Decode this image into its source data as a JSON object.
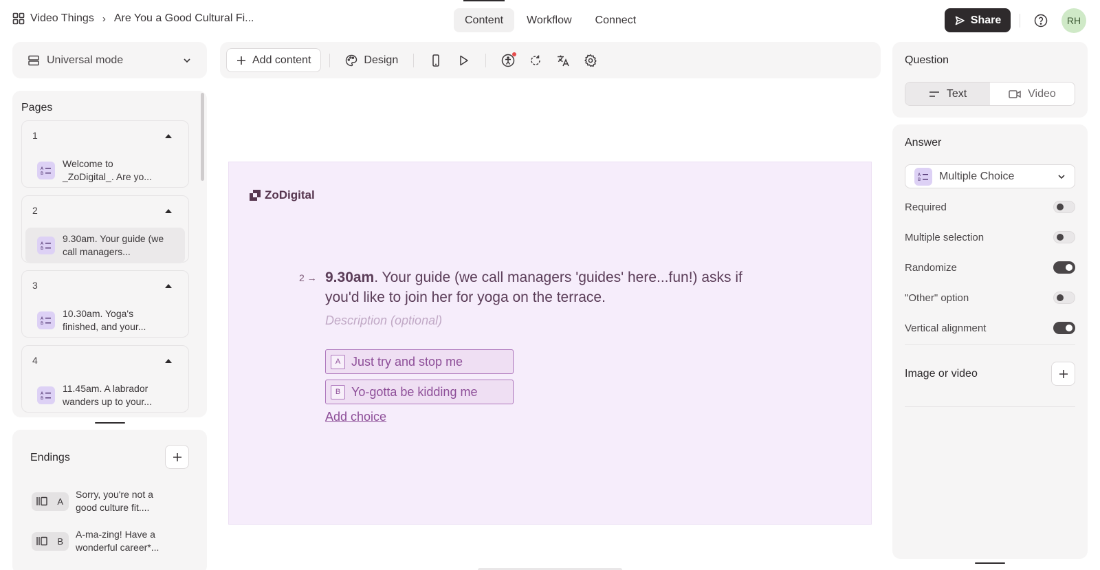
{
  "header": {
    "breadcrumb_root": "Video Things",
    "breadcrumb_current": "Are You a Good Cultural Fi...",
    "tabs": [
      {
        "label": "Content",
        "active": true
      },
      {
        "label": "Workflow",
        "active": false
      },
      {
        "label": "Connect",
        "active": false
      }
    ],
    "share_label": "Share",
    "avatar_initials": "RH"
  },
  "sidebar": {
    "mode_label": "Universal mode",
    "pages_title": "Pages",
    "pages": [
      {
        "number": "1",
        "text": "Welcome to _ZoDigital_. Are yo...",
        "selected": false
      },
      {
        "number": "2",
        "text": "9.30am. Your guide (we call managers...",
        "selected": true
      },
      {
        "number": "3",
        "text": "10.30am. Yoga's finished, and your...",
        "selected": false
      },
      {
        "number": "4",
        "text": "11.45am. A labrador wanders up to your...",
        "selected": false
      }
    ],
    "endings_title": "Endings",
    "endings": [
      {
        "key": "A",
        "text": "Sorry, you're not a good culture fit...."
      },
      {
        "key": "B",
        "text": "A-ma-zing! Have a wonderful career*..."
      }
    ]
  },
  "toolbar": {
    "add_content_label": "Add content",
    "design_label": "Design",
    "icons": [
      "mobile-preview-icon",
      "play-icon",
      "accessibility-icon",
      "refresh-icon",
      "translate-icon",
      "settings-icon"
    ]
  },
  "canvas": {
    "brand": "ZoDigital",
    "question_number": "2",
    "question_bold": "9.30am",
    "question_rest": ". Your guide (we call managers 'guides' here...fun!) asks if you'd like to join her for yoga on the terrace.",
    "description_placeholder": "Description (optional)",
    "choices": [
      {
        "key": "A",
        "label": "Just try and stop me"
      },
      {
        "key": "B",
        "label": "Yo-gotta be kidding me"
      }
    ],
    "add_choice_label": "Add choice"
  },
  "right_panel": {
    "question_title": "Question",
    "question_types": [
      {
        "label": "Text",
        "active": true
      },
      {
        "label": "Video",
        "active": false
      }
    ],
    "answer_title": "Answer",
    "answer_type": "Multiple Choice",
    "settings": [
      {
        "label": "Required",
        "on": false
      },
      {
        "label": "Multiple selection",
        "on": false
      },
      {
        "label": "Randomize",
        "on": true
      },
      {
        "label": "\"Other\" option",
        "on": false
      },
      {
        "label": "Vertical alignment",
        "on": true
      }
    ],
    "image_or_video_label": "Image or video"
  },
  "colors": {
    "canvas_bg": "#f6edfb",
    "accent": "#8d4e98",
    "share_bg": "#2e2a2c",
    "avatar_bg": "#cfe9c7"
  }
}
